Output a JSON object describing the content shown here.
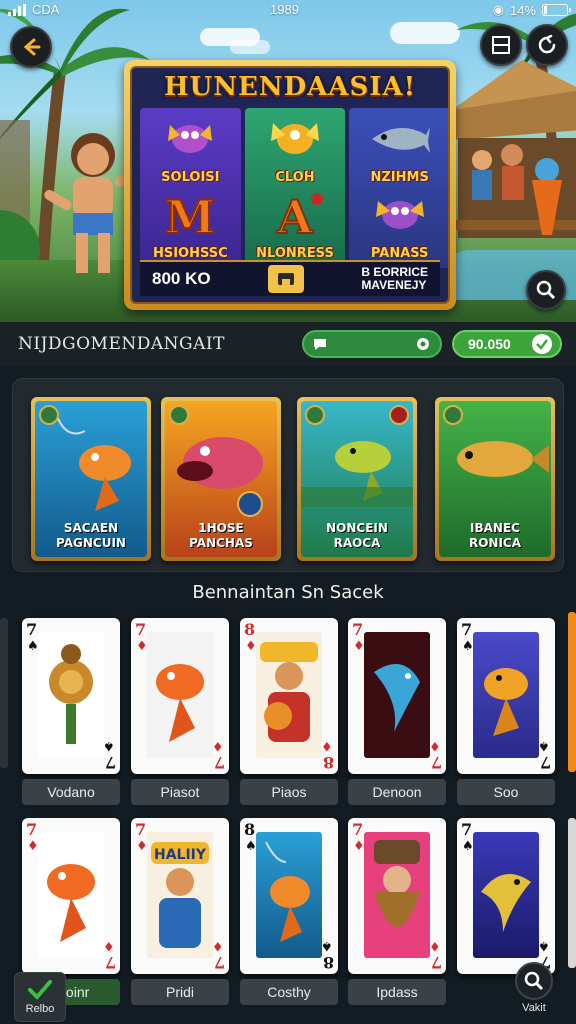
{
  "status_bar": {
    "carrier": "CDA",
    "time": "1989",
    "battery_text": "14%",
    "battery_level": 0.14
  },
  "slot_machine": {
    "title": "HUNENDAASIA!",
    "symbols": [
      {
        "label": "SOLOISI",
        "icon": "purple-fish-icon"
      },
      {
        "label": "CLOH",
        "icon": "golden-fish-icon"
      },
      {
        "label": "NZIHMS",
        "icon": "silver-fish-icon"
      },
      {
        "label": "HSIOHSSC",
        "icon": "letter-m-icon"
      },
      {
        "label": "NLONRESS",
        "icon": "letter-a-icon"
      },
      {
        "label": "PANASS",
        "icon": "purple-fish-icon"
      }
    ],
    "amount": "800 KO",
    "info_line1": "B EORRICE",
    "info_line2": "MAVENEJY"
  },
  "info_bar": {
    "title": "NIJDGOMENDANGAIT",
    "balance": "90.050"
  },
  "featured_cards": [
    {
      "line1": "SACAEN",
      "line2": "PAGNCUIN",
      "theme": "blue"
    },
    {
      "line1": "1HOSE",
      "line2": "PANCHAS",
      "theme": "orange"
    },
    {
      "line1": "NONCEIN",
      "line2": "RAOCA",
      "theme": "teal"
    },
    {
      "line1": "IBANEC",
      "line2": "RONICA",
      "theme": "green"
    }
  ],
  "section_title": "Bennaintan Sn Sacek",
  "cards_row1": [
    {
      "rank": "7",
      "suit": "♠",
      "color": "black",
      "label": "Vodano",
      "art": "shell-creature"
    },
    {
      "rank": "7",
      "suit": "♦",
      "color": "red",
      "label": "Piasot",
      "art": "orange-fish"
    },
    {
      "rank": "8",
      "suit": "♦",
      "color": "red",
      "label": "Piaos",
      "art": "pirate"
    },
    {
      "rank": "7",
      "suit": "♦",
      "color": "red",
      "label": "Denoon",
      "art": "blue-fish"
    },
    {
      "rank": "7",
      "suit": "♠",
      "color": "black",
      "label": "Soo",
      "art": "golden-fish"
    }
  ],
  "cards_row2": [
    {
      "rank": "7",
      "suit": "♦",
      "color": "red",
      "label": "Rloinr",
      "art": "orange-fish"
    },
    {
      "rank": "7",
      "suit": "♦",
      "color": "red",
      "label": "Pridi",
      "art": "hat-girl",
      "banner": "HALIIY"
    },
    {
      "rank": "8",
      "suit": "♠",
      "color": "black",
      "label": "Costhy",
      "art": "hooked-fish"
    },
    {
      "rank": "7",
      "suit": "♦",
      "color": "red",
      "label": "Ipdass",
      "art": "witch"
    },
    {
      "rank": "7",
      "suit": "♠",
      "color": "black",
      "label": "",
      "art": "purple-fish"
    }
  ],
  "bottom_nav": {
    "left_label": "Relbo",
    "right_label": "Vakit"
  },
  "colors": {
    "accent_green": "#3ca43b",
    "gold": "#f1c24a",
    "bg_dark": "#121c22"
  }
}
